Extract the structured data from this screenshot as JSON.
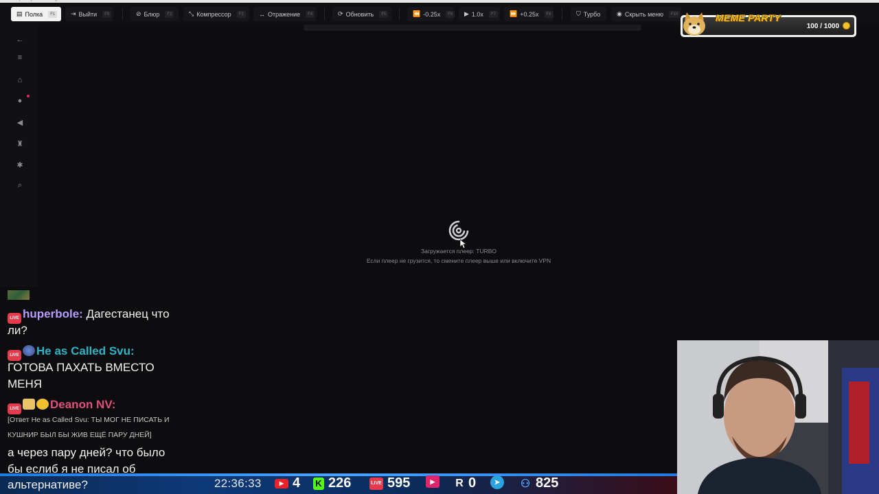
{
  "toolbar": {
    "buttons": [
      {
        "label": "Полка",
        "key": "F1",
        "icon": "book-icon"
      },
      {
        "label": "Выйти",
        "key": "F9",
        "icon": "exit-icon"
      },
      {
        "label": "Блюр",
        "key": "F2",
        "icon": "blur-icon"
      },
      {
        "label": "Компрессор",
        "key": "F3",
        "icon": "compress-icon"
      },
      {
        "label": "Отражение",
        "key": "F4",
        "icon": "mirror-icon"
      },
      {
        "label": "Обновить",
        "key": "F5",
        "icon": "refresh-icon"
      },
      {
        "label": "-0.25x",
        "key": "F6",
        "icon": "rewind-icon"
      },
      {
        "label": "1.0x",
        "key": "F7",
        "icon": "play-icon"
      },
      {
        "label": "+0.25x",
        "key": "F8",
        "icon": "fast-forward-icon"
      },
      {
        "label": "Турбо",
        "icon": "shield-icon"
      },
      {
        "label": "Скрыть меню",
        "key": "F10",
        "icon": "eye-icon"
      }
    ]
  },
  "player": {
    "loading": "Загружается плеер: TURBO",
    "hint": "Если плеер не грузится, то смените плеер выше или включите VPN"
  },
  "meme_party": {
    "title": "MEME PARTY",
    "count": "100 / 1000",
    "coin_color": "#f2c12e"
  },
  "chat": {
    "messages": [
      {
        "nick": "huperbole:",
        "nick_color": "#b89cff",
        "text": "Дагестанец что",
        "text2": "ли?"
      },
      {
        "nick": "He as Called Svu:",
        "nick_color": "#2fb3c6",
        "text": "ГОТОВА ПАХАТЬ ВМЕСТО",
        "text2": "МЕНЯ"
      },
      {
        "nick": "Deanon NV:",
        "nick_color": "#e0507a",
        "reply1": "[Ответ He as Called Svu: ТЫ МОГ НЕ ПИСАТЬ И",
        "reply2": "КУШНИР БЫЛ БЫ ЖИВ ЕЩЁ ПАРУ ДНЕЙ]",
        "text": "а через пару дней? что было",
        "text2": "бы еслиб я не писал об",
        "text3": "альтернативе?"
      }
    ]
  },
  "stats": {
    "time": "22:36:33",
    "youtube": "4",
    "kick": "226",
    "vkplay": "595",
    "rutube": "0",
    "telegram": "825"
  }
}
